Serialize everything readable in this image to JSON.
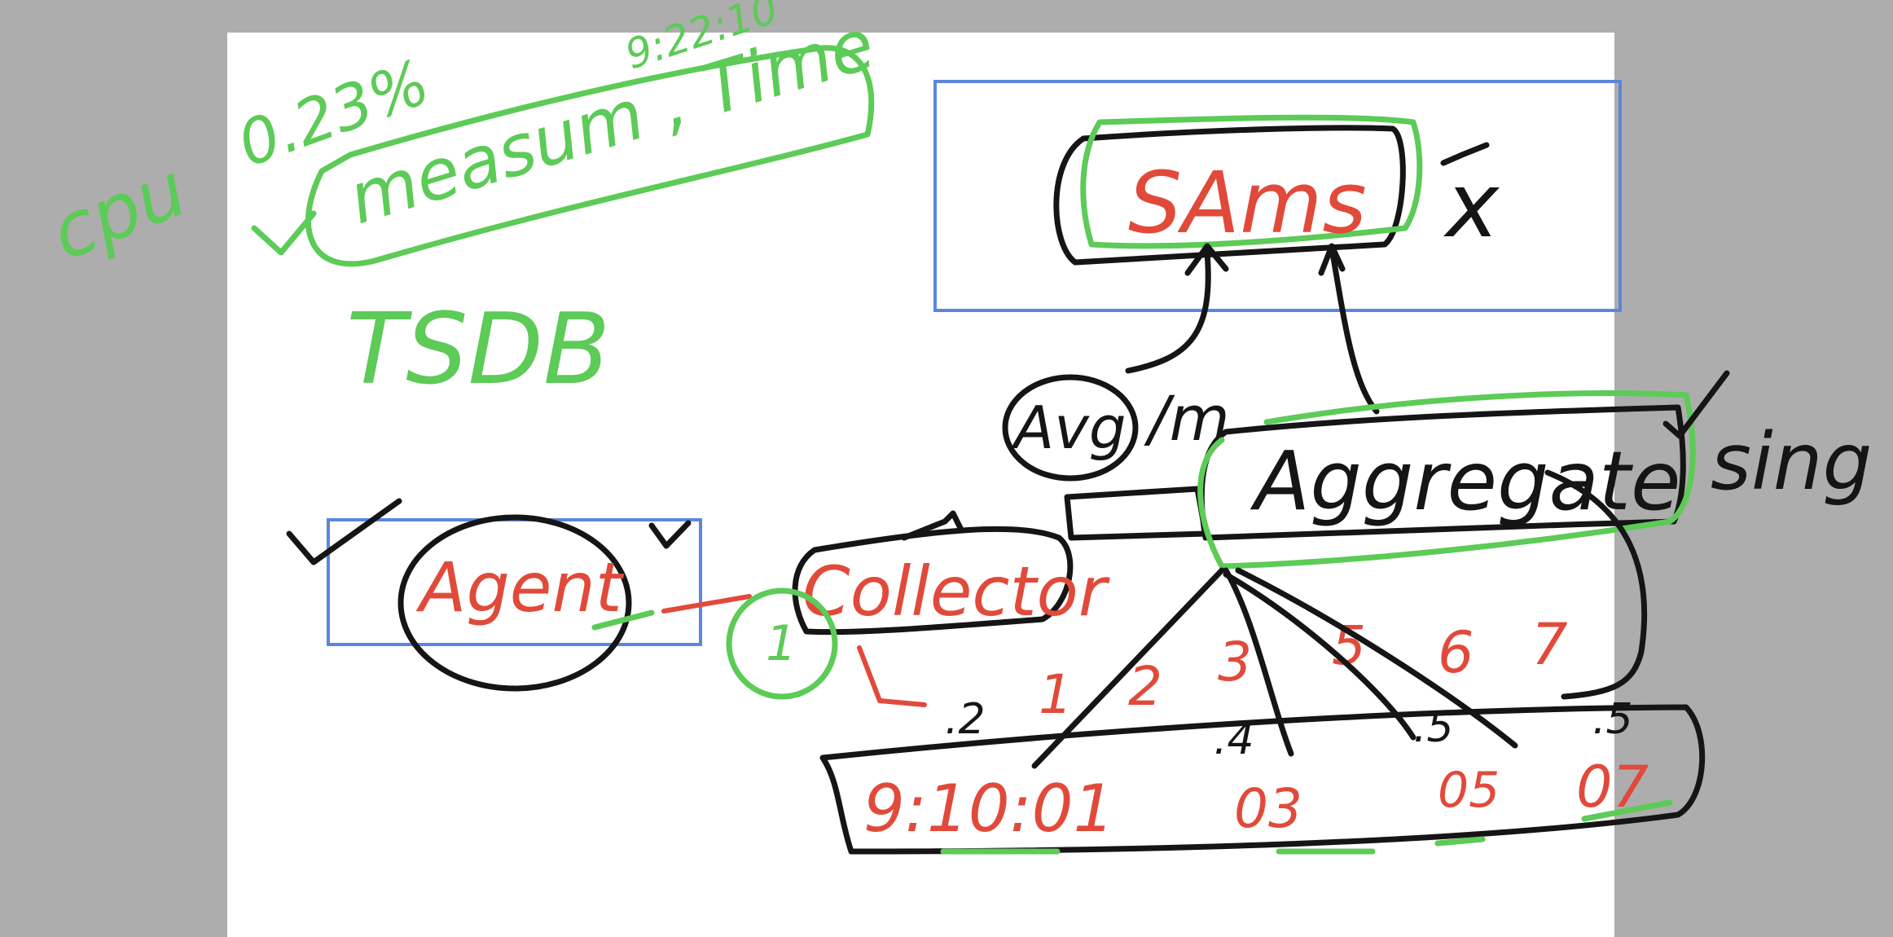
{
  "colors": {
    "background": "#adadad",
    "page": "#ffffff",
    "green_ink": "#5ccb57",
    "black_ink": "#151515",
    "red_ink": "#e14a3a",
    "blue_box": "#5b86dd"
  },
  "notes": {
    "cpu": "cpu",
    "cpu_value": "0.23%",
    "time_value": "9:22:10",
    "measure_time": "measum , Time",
    "tsdb": "TSDB"
  },
  "nodes": {
    "sams": "SAms",
    "aggregate": "Aggregate",
    "agent": "Agent",
    "collector": "Collector",
    "one": "1"
  },
  "labels": {
    "avg": "Avg",
    "per_min": "/m",
    "sing": "sing",
    "x_mark": "x"
  },
  "bucket_numbers": [
    "1",
    "2",
    "3",
    "5",
    "6",
    "7"
  ],
  "bucket_values": [
    ".2",
    ".4",
    ".5",
    ".5"
  ],
  "timeline": {
    "start": "9:10:01",
    "t1": "03",
    "t2": "05",
    "t3": "07"
  }
}
